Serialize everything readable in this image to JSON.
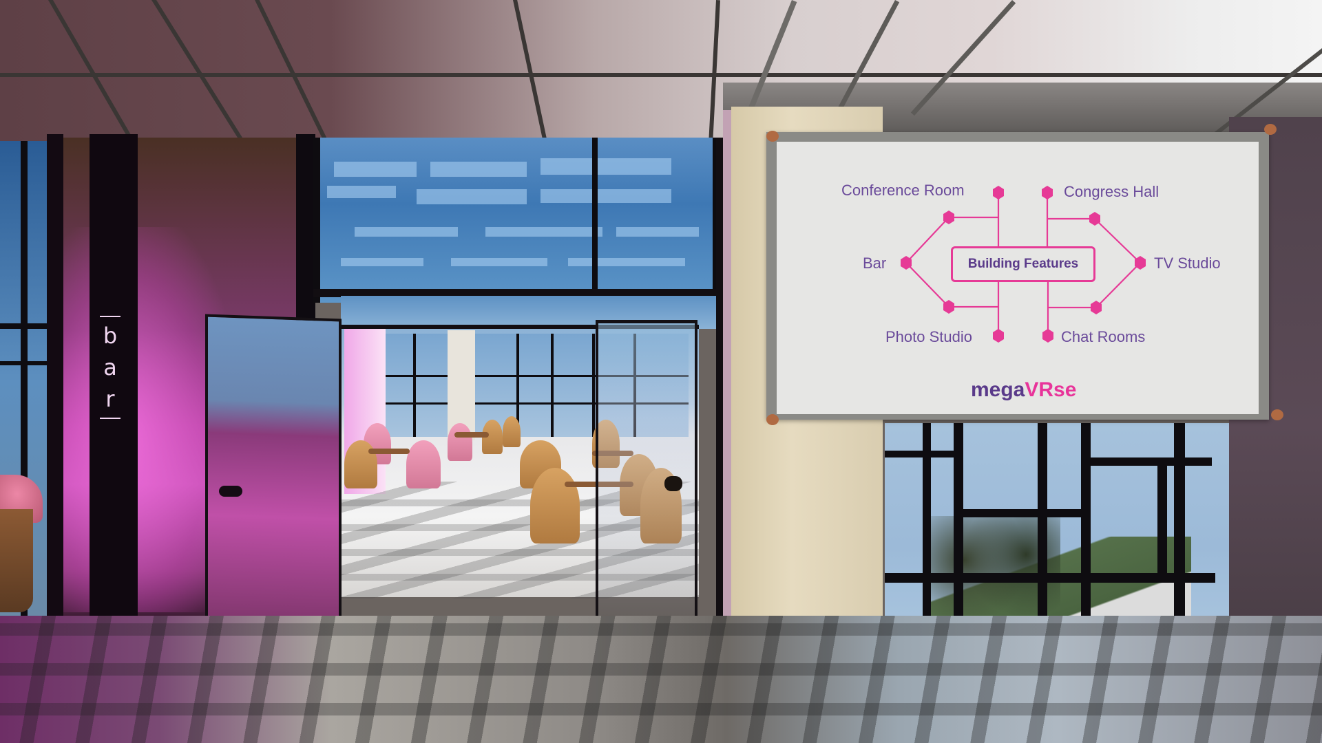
{
  "scene": {
    "type": "3d-virtual-venue",
    "bar_sign": {
      "text": "bar",
      "letters": [
        "b",
        "a",
        "r"
      ]
    }
  },
  "sign": {
    "center_label": "Building Features",
    "features": [
      {
        "label": "Conference Room",
        "side": "left",
        "position": "top"
      },
      {
        "label": "Bar",
        "side": "left",
        "position": "middle"
      },
      {
        "label": "Photo Studio",
        "side": "left",
        "position": "bottom"
      },
      {
        "label": "Congress Hall",
        "side": "right",
        "position": "top"
      },
      {
        "label": "TV Studio",
        "side": "right",
        "position": "middle"
      },
      {
        "label": "Chat Rooms",
        "side": "right",
        "position": "bottom"
      }
    ],
    "brand": {
      "part1": "mega",
      "part2": "VRse"
    },
    "colors": {
      "accent": "#e63a96",
      "text": "#6a4a9a",
      "brand_dark": "#5a3a8a",
      "board": "#e6e6e4"
    }
  }
}
